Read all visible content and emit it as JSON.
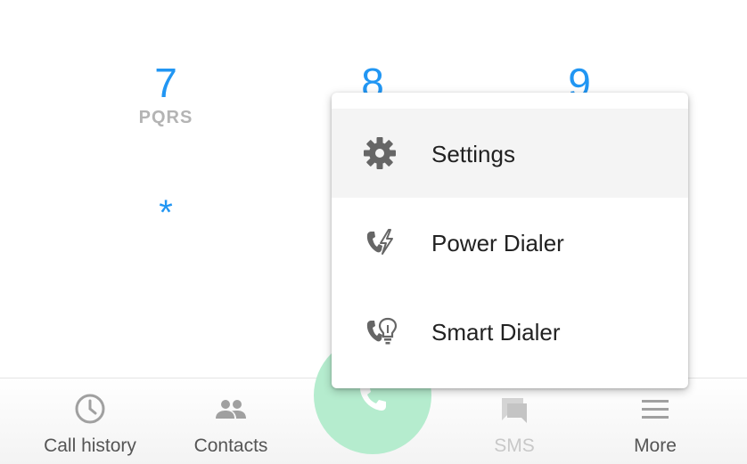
{
  "keypad": {
    "keys": [
      {
        "digit": "7",
        "letters": "PQRS"
      },
      {
        "digit": "8",
        "letters": ""
      },
      {
        "digit": "9",
        "letters": ""
      },
      {
        "digit": "*",
        "letters": ""
      }
    ]
  },
  "menu": {
    "items": [
      {
        "label": "Settings",
        "icon": "gear-icon",
        "highlighted": true
      },
      {
        "label": "Power Dialer",
        "icon": "power-dialer-icon"
      },
      {
        "label": "Smart Dialer",
        "icon": "smart-dialer-icon"
      }
    ]
  },
  "bottom_nav": {
    "items": [
      {
        "label": "Call history",
        "icon": "clock-icon"
      },
      {
        "label": "Contacts",
        "icon": "contacts-icon"
      },
      {
        "label": "SMS",
        "icon": "sms-icon",
        "disabled": true
      },
      {
        "label": "More",
        "icon": "menu-icon"
      }
    ],
    "call_button_icon": "phone-icon"
  },
  "colors": {
    "accent": "#2196f3",
    "call_button": "#b5ecce",
    "icon_gray": "#757575",
    "text": "#222222"
  }
}
